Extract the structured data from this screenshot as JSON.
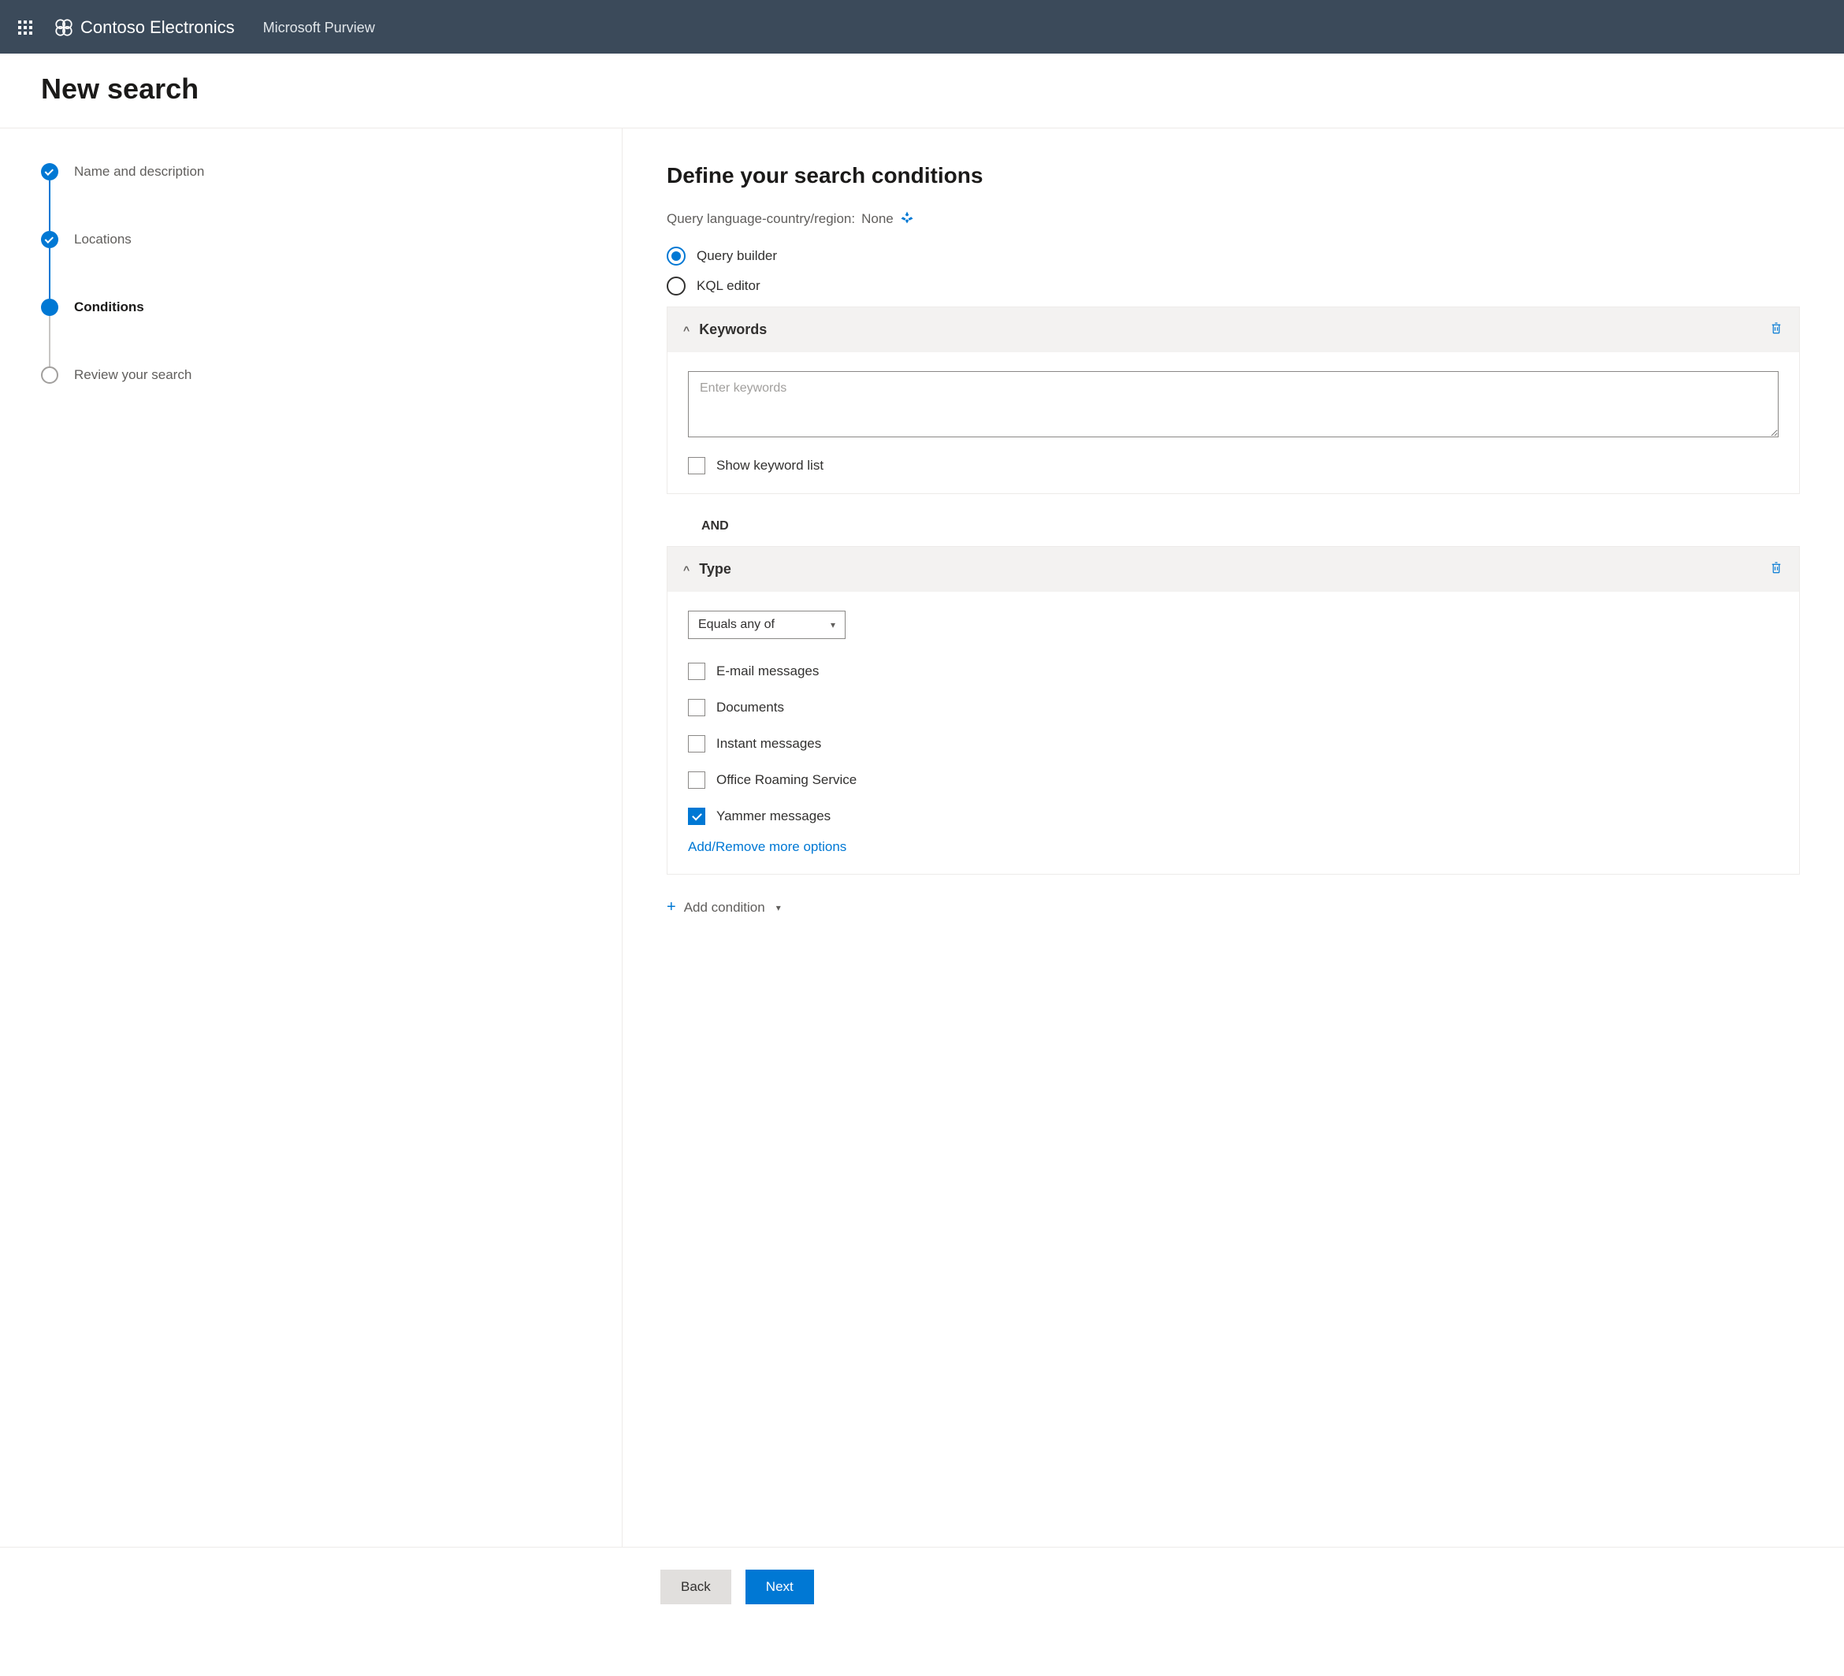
{
  "topbar": {
    "org": "Contoso Electronics",
    "product": "Microsoft Purview"
  },
  "page_title": "New search",
  "steps": [
    {
      "label": "Name and description",
      "state": "done"
    },
    {
      "label": "Locations",
      "state": "done"
    },
    {
      "label": "Conditions",
      "state": "current"
    },
    {
      "label": "Review your search",
      "state": "upcoming"
    }
  ],
  "main": {
    "heading": "Define your search conditions",
    "query_lang_label": "Query language-country/region:",
    "query_lang_value": "None",
    "radio_builder": "Query builder",
    "radio_kql": "KQL editor",
    "keywords_card": {
      "title": "Keywords",
      "placeholder": "Enter keywords",
      "show_list_label": "Show keyword list"
    },
    "and_label": "AND",
    "type_card": {
      "title": "Type",
      "operator": "Equals any of",
      "options": [
        {
          "label": "E-mail messages",
          "checked": false
        },
        {
          "label": "Documents",
          "checked": false
        },
        {
          "label": "Instant messages",
          "checked": false
        },
        {
          "label": "Office Roaming Service",
          "checked": false
        },
        {
          "label": "Yammer messages",
          "checked": true
        }
      ],
      "more_link": "Add/Remove more options"
    },
    "add_condition": "Add condition"
  },
  "footer": {
    "back": "Back",
    "next": "Next"
  }
}
